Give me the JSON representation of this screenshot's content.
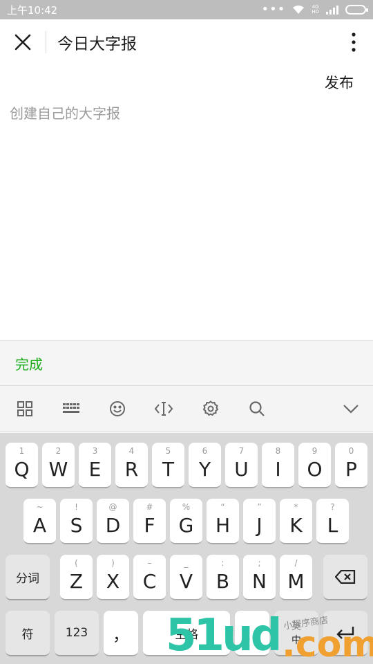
{
  "status_bar": {
    "time": "上午10:42",
    "network_top": "4G",
    "network_bottom": "HD"
  },
  "header": {
    "title": "今日大字报",
    "close_icon": "close-icon",
    "more_icon": "more-vertical-icon"
  },
  "editor": {
    "publish_label": "发布",
    "placeholder": "创建自己的大字报",
    "value": ""
  },
  "done_bar": {
    "done_label": "完成",
    "accent": "#1aad19"
  },
  "keyboard_toolbar": {
    "items": [
      "grid-icon",
      "keyboard-icon",
      "emoji-icon",
      "cursor-icon",
      "settings-icon",
      "search-icon",
      "collapse-icon"
    ]
  },
  "keyboard": {
    "row1": [
      {
        "sub": "1",
        "main": "Q"
      },
      {
        "sub": "2",
        "main": "W"
      },
      {
        "sub": "3",
        "main": "E"
      },
      {
        "sub": "4",
        "main": "R"
      },
      {
        "sub": "5",
        "main": "T"
      },
      {
        "sub": "6",
        "main": "Y"
      },
      {
        "sub": "7",
        "main": "U"
      },
      {
        "sub": "8",
        "main": "I"
      },
      {
        "sub": "9",
        "main": "O"
      },
      {
        "sub": "0",
        "main": "P"
      }
    ],
    "row2": [
      {
        "sub": "~",
        "main": "A"
      },
      {
        "sub": "!",
        "main": "S"
      },
      {
        "sub": "@",
        "main": "D"
      },
      {
        "sub": "#",
        "main": "F"
      },
      {
        "sub": "%",
        "main": "G"
      },
      {
        "sub": "“",
        "main": "H"
      },
      {
        "sub": "”",
        "main": "J"
      },
      {
        "sub": "*",
        "main": "K"
      },
      {
        "sub": "?",
        "main": "L"
      }
    ],
    "row3": [
      {
        "sub": "(",
        "main": "Z"
      },
      {
        "sub": ")",
        "main": "X"
      },
      {
        "sub": "–",
        "main": "C"
      },
      {
        "sub": "_",
        "main": "V"
      },
      {
        "sub": ":",
        "main": "B"
      },
      {
        "sub": ";",
        "main": "N"
      },
      {
        "sub": "/",
        "main": "M"
      }
    ],
    "segment_label": "分词",
    "symbol_label": "符",
    "numbers_label": "123",
    "comma_label": "，",
    "space_label": "空格",
    "period_label": "。",
    "lang_en": "英",
    "lang_zh": "中"
  },
  "watermark": {
    "digits": "51ud",
    "suffix": ".com",
    "tag": "小程序商店"
  }
}
